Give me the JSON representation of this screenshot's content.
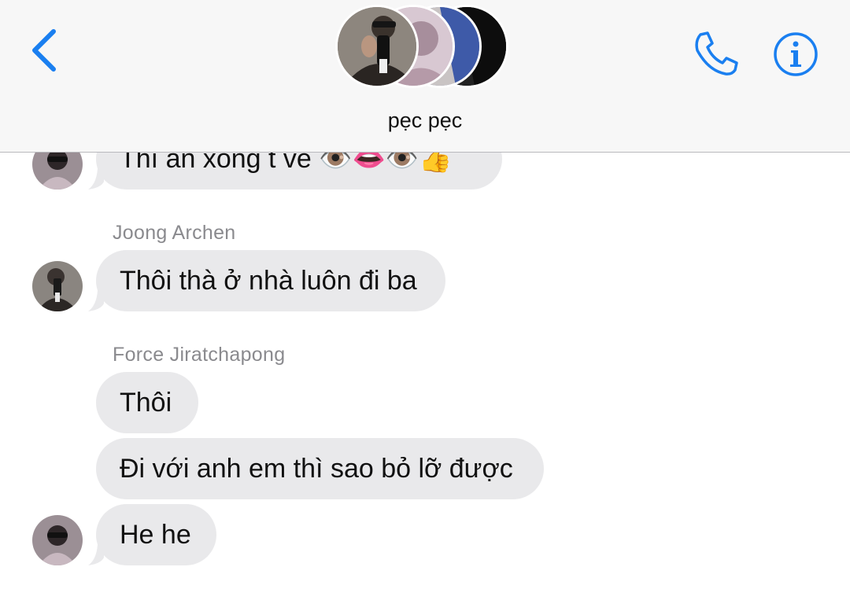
{
  "header": {
    "group_name": "pẹc pẹc"
  },
  "messages": [
    {
      "text": "Thì ăn xong t về 👁️👄👁️👍"
    },
    {
      "sender": "Joong Archen",
      "text": "Thôi thà ở nhà luôn đi ba"
    },
    {
      "sender": "Force Jiratchapong",
      "texts": [
        "Thôi",
        "Đi với anh em thì sao bỏ lỡ được",
        "He he"
      ]
    }
  ],
  "colors": {
    "accent": "#1a7ff0",
    "bubble": "#e9e9eb",
    "header_bg": "#f7f7f7",
    "sender_label": "#8a8a8e"
  }
}
